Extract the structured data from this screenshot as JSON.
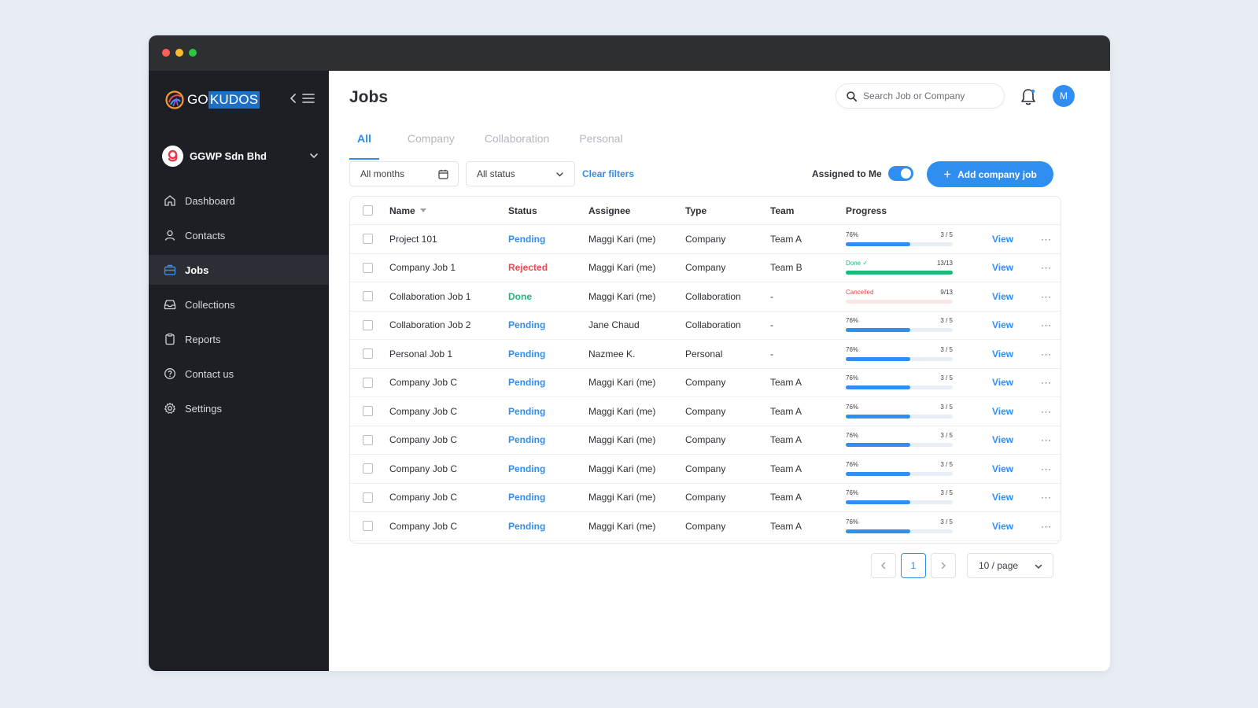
{
  "app": {
    "logo_part1": "GO",
    "logo_part2": "KUDOS"
  },
  "org": {
    "name": "GGWP Sdn Bhd",
    "initial": "g"
  },
  "nav": [
    {
      "label": "Dashboard",
      "icon": "home-icon"
    },
    {
      "label": "Contacts",
      "icon": "user-icon"
    },
    {
      "label": "Jobs",
      "icon": "briefcase-icon",
      "active": true
    },
    {
      "label": "Collections",
      "icon": "inbox-icon"
    },
    {
      "label": "Reports",
      "icon": "clipboard-icon"
    },
    {
      "label": "Contact us",
      "icon": "help-circle-icon"
    },
    {
      "label": "Settings",
      "icon": "gear-icon"
    }
  ],
  "header": {
    "title": "Jobs",
    "search_placeholder": "Search Job or Company",
    "avatar_initial": "M"
  },
  "tabs": [
    {
      "label": "All",
      "active": true
    },
    {
      "label": "Company"
    },
    {
      "label": "Collaboration"
    },
    {
      "label": "Personal"
    }
  ],
  "filters": {
    "months": "All months",
    "status": "All status",
    "clear": "Clear filters",
    "assigned_label": "Assigned to Me",
    "assigned_on": true,
    "add_button": "Add company job"
  },
  "table": {
    "columns": [
      "Name",
      "Status",
      "Assignee",
      "Type",
      "Team",
      "Progress"
    ],
    "view_label": "View",
    "more_label": "···",
    "rows": [
      {
        "name": "Project 101",
        "status": "Pending",
        "assignee": "Maggi Kari (me)",
        "type": "Company",
        "team": "Team A",
        "progress_label": "76%",
        "progress_count": "3 / 5",
        "progress": 0.6,
        "progress_state": "normal"
      },
      {
        "name": "Company Job 1",
        "status": "Rejected",
        "assignee": "Maggi Kari (me)",
        "type": "Company",
        "team": "Team B",
        "progress_label": "Done ✓",
        "progress_count": "13/13",
        "progress": 1.0,
        "progress_state": "done"
      },
      {
        "name": "Collaboration Job 1",
        "status": "Done",
        "assignee": "Maggi Kari (me)",
        "type": "Collaboration",
        "team": "-",
        "progress_label": "Cancelled",
        "progress_count": "9/13",
        "progress": 0.0,
        "progress_state": "cancelled"
      },
      {
        "name": "Collaboration Job 2",
        "status": "Pending",
        "assignee": "Jane Chaud",
        "type": "Collaboration",
        "team": "-",
        "progress_label": "76%",
        "progress_count": "3 / 5",
        "progress": 0.6,
        "progress_state": "normal"
      },
      {
        "name": "Personal Job 1",
        "status": "Pending",
        "assignee": "Nazmee K.",
        "type": "Personal",
        "team": "-",
        "progress_label": "76%",
        "progress_count": "3 / 5",
        "progress": 0.6,
        "progress_state": "normal"
      },
      {
        "name": "Company Job C",
        "status": "Pending",
        "assignee": "Maggi Kari (me)",
        "type": "Company",
        "team": "Team A",
        "progress_label": "76%",
        "progress_count": "3 / 5",
        "progress": 0.6,
        "progress_state": "normal"
      },
      {
        "name": "Company Job C",
        "status": "Pending",
        "assignee": "Maggi Kari (me)",
        "type": "Company",
        "team": "Team A",
        "progress_label": "76%",
        "progress_count": "3 / 5",
        "progress": 0.6,
        "progress_state": "normal"
      },
      {
        "name": "Company Job C",
        "status": "Pending",
        "assignee": "Maggi Kari (me)",
        "type": "Company",
        "team": "Team A",
        "progress_label": "76%",
        "progress_count": "3 / 5",
        "progress": 0.6,
        "progress_state": "normal"
      },
      {
        "name": "Company Job C",
        "status": "Pending",
        "assignee": "Maggi Kari (me)",
        "type": "Company",
        "team": "Team A",
        "progress_label": "76%",
        "progress_count": "3 / 5",
        "progress": 0.6,
        "progress_state": "normal"
      },
      {
        "name": "Company Job C",
        "status": "Pending",
        "assignee": "Maggi Kari (me)",
        "type": "Company",
        "team": "Team A",
        "progress_label": "76%",
        "progress_count": "3 / 5",
        "progress": 0.6,
        "progress_state": "normal"
      },
      {
        "name": "Company Job C",
        "status": "Pending",
        "assignee": "Maggi Kari (me)",
        "type": "Company",
        "team": "Team A",
        "progress_label": "76%",
        "progress_count": "3 / 5",
        "progress": 0.6,
        "progress_state": "normal"
      }
    ]
  },
  "pagination": {
    "prev_icon": "chevron-left-icon",
    "next_icon": "chevron-right-icon",
    "current_page": "1",
    "per_page": "10 / page"
  },
  "colors": {
    "accent": "#2f8ef0",
    "success": "#1db97b",
    "danger": "#ea4a4a",
    "sidebar": "#1d1f24"
  }
}
